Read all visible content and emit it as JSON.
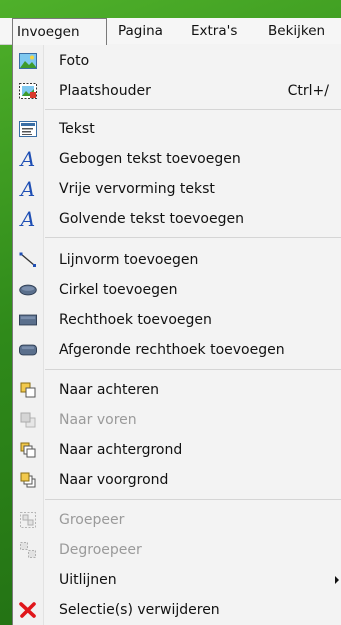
{
  "menubar": {
    "items": [
      "Invoegen",
      "Pagina",
      "Extra's",
      "Bekijken"
    ]
  },
  "menu": {
    "items": [
      {
        "label": "Foto",
        "icon": "photo-icon"
      },
      {
        "label": "Plaatshouder",
        "icon": "placeholder-icon",
        "shortcut": "Ctrl+/"
      },
      {
        "label": "Tekst",
        "icon": "text-box-icon"
      },
      {
        "label": "Gebogen tekst toevoegen",
        "icon": "curved-text-icon"
      },
      {
        "label": "Vrije vervorming tekst",
        "icon": "freeform-text-icon"
      },
      {
        "label": "Golvende tekst toevoegen",
        "icon": "wavy-text-icon"
      },
      {
        "label": "Lijnvorm toevoegen",
        "icon": "line-shape-icon"
      },
      {
        "label": "Cirkel toevoegen",
        "icon": "circle-icon"
      },
      {
        "label": "Rechthoek toevoegen",
        "icon": "rectangle-icon"
      },
      {
        "label": "Afgeronde rechthoek toevoegen",
        "icon": "rounded-rectangle-icon"
      },
      {
        "label": "Naar achteren",
        "icon": "send-backward-icon"
      },
      {
        "label": "Naar voren",
        "icon": "bring-forward-icon",
        "disabled": true
      },
      {
        "label": "Naar achtergrond",
        "icon": "send-to-back-icon"
      },
      {
        "label": "Naar voorgrond",
        "icon": "bring-to-front-icon"
      },
      {
        "label": "Groepeer",
        "icon": "group-icon",
        "disabled": true
      },
      {
        "label": "Degroepeer",
        "icon": "ungroup-icon",
        "disabled": true
      },
      {
        "label": "Uitlijnen",
        "icon": "",
        "submenu": true
      },
      {
        "label": "Selectie(s) verwijderen",
        "icon": "delete-icon"
      }
    ]
  },
  "colors": {
    "background": "#3a9a22",
    "menu": "#f3f3f3",
    "text": "#111111",
    "disabled_text": "#9a9a9a",
    "text_icon_blue": "#1f4fb4",
    "delete_red": "#e0161b"
  }
}
